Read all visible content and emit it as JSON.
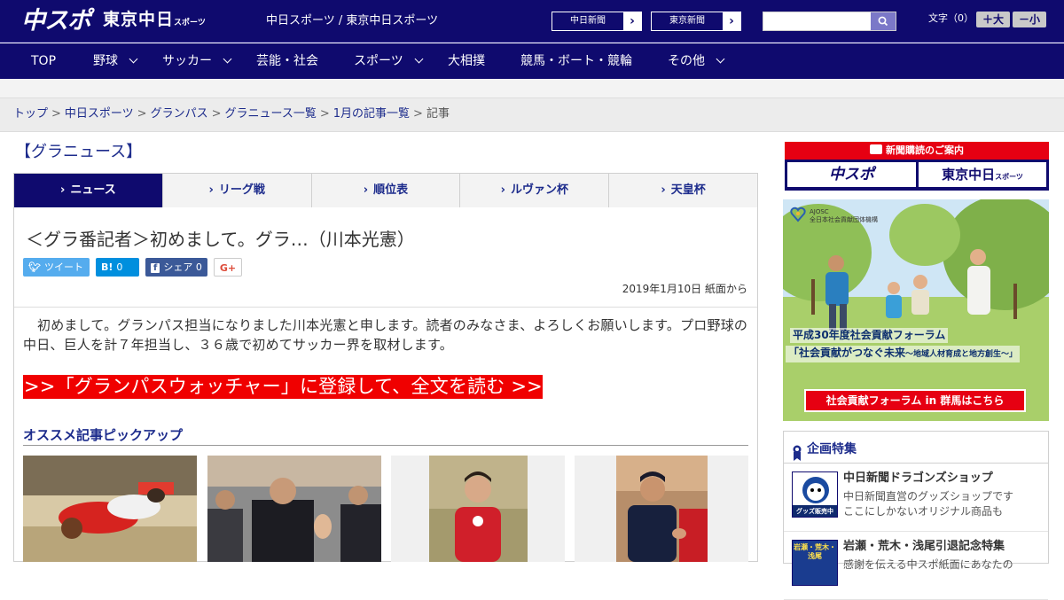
{
  "header": {
    "logo_chunichi": "中スポ",
    "logo_tokyo": "東京中日",
    "logo_tokyo_small": "スポーツ",
    "site_name": "中日スポーツ / 東京中日スポーツ",
    "paper_buttons": [
      "中日新聞",
      "東京新聞"
    ],
    "search_placeholder": "",
    "font_size_label": "文字（0）",
    "font_bigger": "＋大",
    "font_smaller": "－小"
  },
  "nav": {
    "items": [
      {
        "label": "TOP",
        "dropdown": false
      },
      {
        "label": "野球",
        "dropdown": true
      },
      {
        "label": "サッカー",
        "dropdown": true
      },
      {
        "label": "芸能・社会",
        "dropdown": false
      },
      {
        "label": "スポーツ",
        "dropdown": true
      },
      {
        "label": "大相撲",
        "dropdown": false
      },
      {
        "label": "競馬・ボート・競輪",
        "dropdown": false
      },
      {
        "label": "その他",
        "dropdown": true
      }
    ]
  },
  "breadcrumb": {
    "items": [
      "トップ",
      "中日スポーツ",
      "グランパス",
      "グラニュース一覧",
      "1月の記事一覧"
    ],
    "current": "記事",
    "separator": ">"
  },
  "section": {
    "title": "【グラニュース】",
    "tabs": [
      "ニュース",
      "リーグ戦",
      "順位表",
      "ルヴァン杯",
      "天皇杯"
    ],
    "active_tab": 0,
    "tab_prefix": "›"
  },
  "article": {
    "headline": "＜グラ番記者＞初めまして。グラ…（川本光憲）",
    "share": {
      "tweet": "ツイート",
      "hatena_icon": "B!",
      "hatena_count": "0",
      "facebook_label": "シェア",
      "facebook_count": "0",
      "gplus": "G+"
    },
    "dateline": "2019年1月10日 紙面から",
    "body": "初めまして。グランパス担当になりました川本光憲と申します。読者のみなさま、よろしくお願いします。プロ野球の中日、巨人を計７年担当し、３６歳で初めてサッカー界を取材します。",
    "cta": ">>「グランパスウォッチャー」に登録して、全文を読む >>",
    "pickup_title": "オススメ記事ピックアップ"
  },
  "sidebar": {
    "subscribe_title": "新聞購読のご案内",
    "subscribe_chunichi": "中スポ",
    "subscribe_tokyo": "東京中日",
    "subscribe_tokyo_small": "スポーツ",
    "ad": {
      "org_abbr": "AJOSC",
      "org_name": "全日本社会貢献団体機構",
      "line1": "平成30年度社会貢献フォーラム",
      "line2": "「社会貢献がつなぐ未来",
      "line2_sub": "～地域人材育成と地方創生～」",
      "button": "社会貢献フォーラム in 群馬はこちら"
    },
    "features_title": "企画特集",
    "features": [
      {
        "title": "中日新聞ドラゴンズショップ",
        "desc1": "中日新聞直営のグッズショップです",
        "desc2": "ここにしかないオリジナル商品も",
        "badge": "グッズ販売中"
      },
      {
        "title": "岩瀬・荒木・浅尾引退記念特集",
        "desc1": "感謝を伝える中スポ紙面にあなたの",
        "desc2": "",
        "badge": "岩瀬・荒木・浅尾"
      }
    ]
  },
  "colors": {
    "brand_navy": "#0f0a6e",
    "link_blue": "#1d2c8c",
    "cta_red": "#f00000"
  }
}
